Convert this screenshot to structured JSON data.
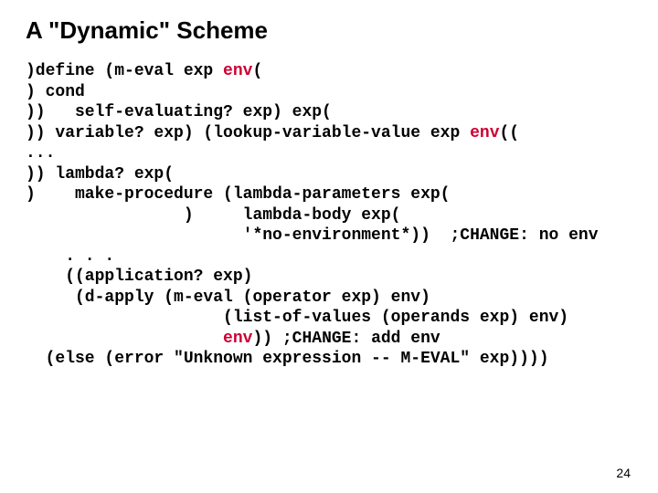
{
  "title": "A \"Dynamic\" Scheme",
  "code": {
    "l1a": ")define (m-eval exp ",
    "l1_env": "env",
    "l1b": "(",
    "l2": ") cond",
    "l3": "))   self-evaluating? exp) exp(",
    "l4a": ")) variable? exp) (lookup-variable-value exp ",
    "l4_env": "env",
    "l4b": "((",
    "ellipsis1": "...",
    "l5": ")) lambda? exp(",
    "l6": ")    make-procedure (lambda-parameters exp(",
    "l7": "                )     lambda-body exp(",
    "l8": "                      '*no-environment*))  ;CHANGE: no env",
    "ellipsis2": "    . . .",
    "l9": "    ((application? exp)",
    "l10": "     (d-apply (m-eval (operator exp) env)",
    "l11": "                    (list-of-values (operands exp) env)",
    "l12a": "                    ",
    "l12_env": "env",
    "l12b": ")) ;CHANGE: add env",
    "l13": "  (else (error \"Unknown expression -- M-EVAL\" exp))))"
  },
  "page_number": "24"
}
